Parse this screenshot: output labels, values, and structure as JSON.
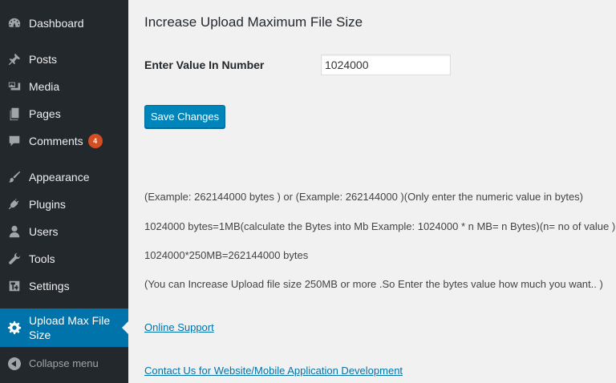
{
  "sidebar": {
    "items": [
      {
        "label": "Dashboard",
        "icon": "dashboard-icon"
      },
      {
        "label": "Posts",
        "icon": "pin-icon"
      },
      {
        "label": "Media",
        "icon": "media-icon"
      },
      {
        "label": "Pages",
        "icon": "pages-icon"
      },
      {
        "label": "Comments",
        "icon": "comment-icon",
        "badge": "4"
      },
      {
        "label": "Appearance",
        "icon": "brush-icon"
      },
      {
        "label": "Plugins",
        "icon": "plug-icon"
      },
      {
        "label": "Users",
        "icon": "user-icon"
      },
      {
        "label": "Tools",
        "icon": "wrench-icon"
      },
      {
        "label": "Settings",
        "icon": "settings-icon"
      },
      {
        "label": "Upload Max File Size",
        "icon": "gear-icon"
      }
    ],
    "collapse_label": "Collapse menu"
  },
  "main": {
    "title": "Increase Upload Maximum File Size",
    "field_label": "Enter Value In Number",
    "field_value": "1024000",
    "save_label": "Save Changes",
    "info": [
      "(Example: 262144000 bytes ) or (Example: 262144000 )(Only enter the numeric value in bytes)",
      "1024000 bytes=1MB(calculate the Bytes into Mb Example: 1024000 * n MB= n Bytes)(n= no of value )",
      "1024000*250MB=262144000 bytes",
      "(You can Increase Upload file size 250MB or more .So Enter the bytes value how much you want.. )"
    ],
    "links": {
      "support": "Online Support",
      "contact": "Contact Us for Website/Mobile Application Development"
    }
  },
  "colors": {
    "sidebar_bg": "#23282d",
    "active_bg": "#0073aa",
    "button_bg": "#0085ba",
    "badge_bg": "#d54e21",
    "link": "#0073aa"
  }
}
